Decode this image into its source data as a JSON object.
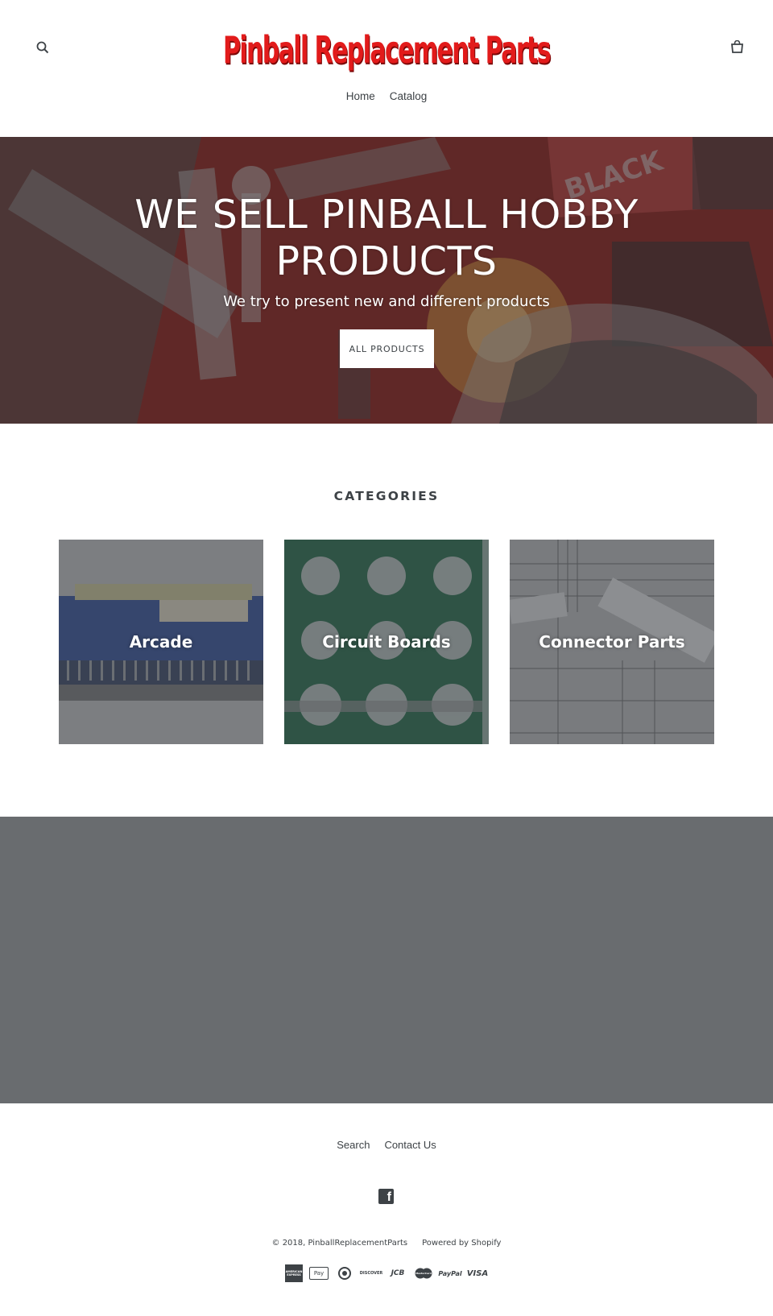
{
  "header": {
    "logo_text": "Pinball Replacement Parts",
    "nav": [
      "Home",
      "Catalog"
    ]
  },
  "hero": {
    "title": "WE SELL PINBALL HOBBY PRODUCTS",
    "subtitle": "We try to present new and different products",
    "button_label": "ALL PRODUCTS"
  },
  "categories": {
    "title": "CATEGORIES",
    "items": [
      {
        "label": "Arcade"
      },
      {
        "label": "Circuit Boards"
      },
      {
        "label": "Connector Parts"
      }
    ]
  },
  "footer": {
    "links": [
      "Search",
      "Contact Us"
    ],
    "copyright": "© 2018, PinballReplacementParts",
    "powered": "Powered by Shopify",
    "payments": [
      "AMERICAN EXPRESS",
      "Pay",
      "diners",
      "DISCOVER",
      "JCB",
      "MasterCard",
      "PayPal",
      "VISA"
    ]
  },
  "colors": {
    "logo": "#e21b1b",
    "text": "#3d4246",
    "band": "#696c6f"
  }
}
